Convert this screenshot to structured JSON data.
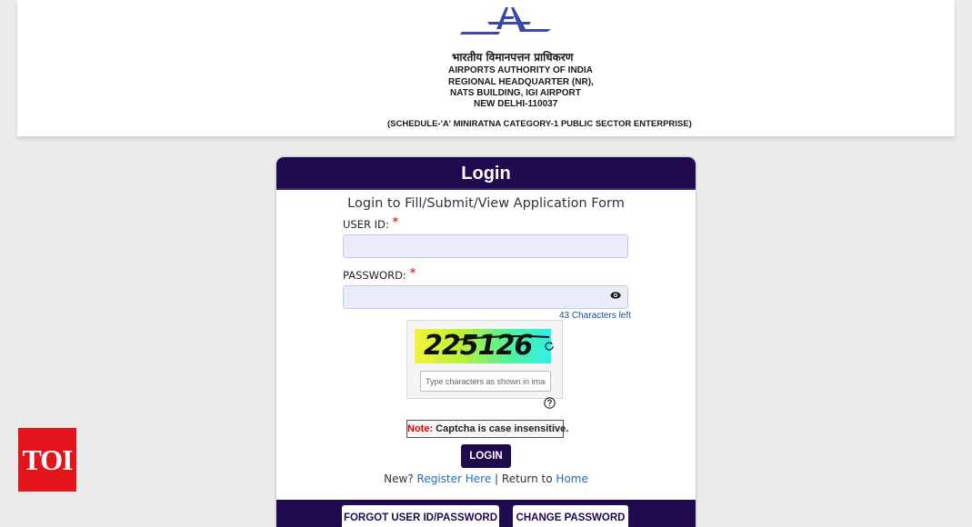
{
  "header": {
    "hindi_name": "भारतीय विमानपत्तन प्राधिकरण",
    "org_name": "AIRPORTS AUTHORITY OF INDIA",
    "region": "REGIONAL HEADQUARTER (NR),",
    "building": "NATS BUILDING, IGI AIRPORT",
    "city": "NEW DELHI-110037",
    "category": "(SCHEDULE-'A' MINIRATNA CATEGORY-1 PUBLIC SECTOR ENTERPRISE)",
    "logo_icon": "aai-logo-icon",
    "brand_color": "#3a46a8"
  },
  "login": {
    "title": "Login",
    "subtitle": "Login to Fill/Submit/View Application Form",
    "user_id_label": "USER ID:",
    "user_id_value": "",
    "password_label": "PASSWORD:",
    "password_value": "",
    "required_mark": "*",
    "chars_left": "43 Characters left",
    "captcha_text": "225126",
    "captcha_placeholder": "Type characters as shown in image",
    "note_prefix": "Note:",
    "note_text": " Captcha is case insensitive.",
    "login_button": "LOGIN",
    "new_text": "New?",
    "register_link": "Register Here",
    "separator": "|",
    "return_text": "Return to",
    "home_link": "Home",
    "forgot_button": "FORGOT USER ID/PASSWORD",
    "change_button": "CHANGE PASSWORD",
    "accent_color": "#1f0a4e",
    "link_color": "#2a6bb5",
    "required_color": "#e00000"
  },
  "watermark": {
    "text": "TOI",
    "color": "#e3141b"
  }
}
